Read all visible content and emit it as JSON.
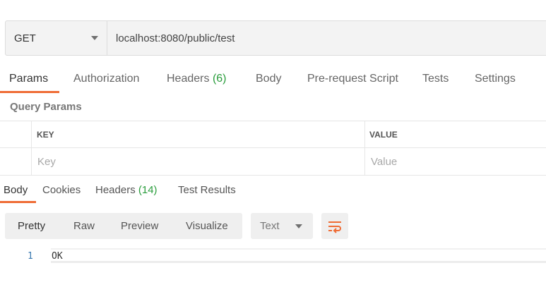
{
  "request": {
    "method": "GET",
    "url": "localhost:8080/public/test"
  },
  "request_tabs": {
    "params": "Params",
    "authorization": "Authorization",
    "headers": "Headers",
    "headers_count": "(6)",
    "body": "Body",
    "pre_request_script": "Pre-request Script",
    "tests": "Tests",
    "settings": "Settings"
  },
  "query_params": {
    "title": "Query Params",
    "key_header": "KEY",
    "value_header": "VALUE",
    "key_placeholder": "Key",
    "value_placeholder": "Value"
  },
  "response_tabs": {
    "body": "Body",
    "cookies": "Cookies",
    "headers": "Headers",
    "headers_count": "(14)",
    "test_results": "Test Results"
  },
  "response_toolbar": {
    "pretty": "Pretty",
    "raw": "Raw",
    "preview": "Preview",
    "visualize": "Visualize",
    "format": "Text"
  },
  "response_body": {
    "line_number": "1",
    "content": "OK"
  },
  "colors": {
    "accent": "#ef6c35",
    "count": "#2a9d3c",
    "line_number": "#3a79b0"
  }
}
